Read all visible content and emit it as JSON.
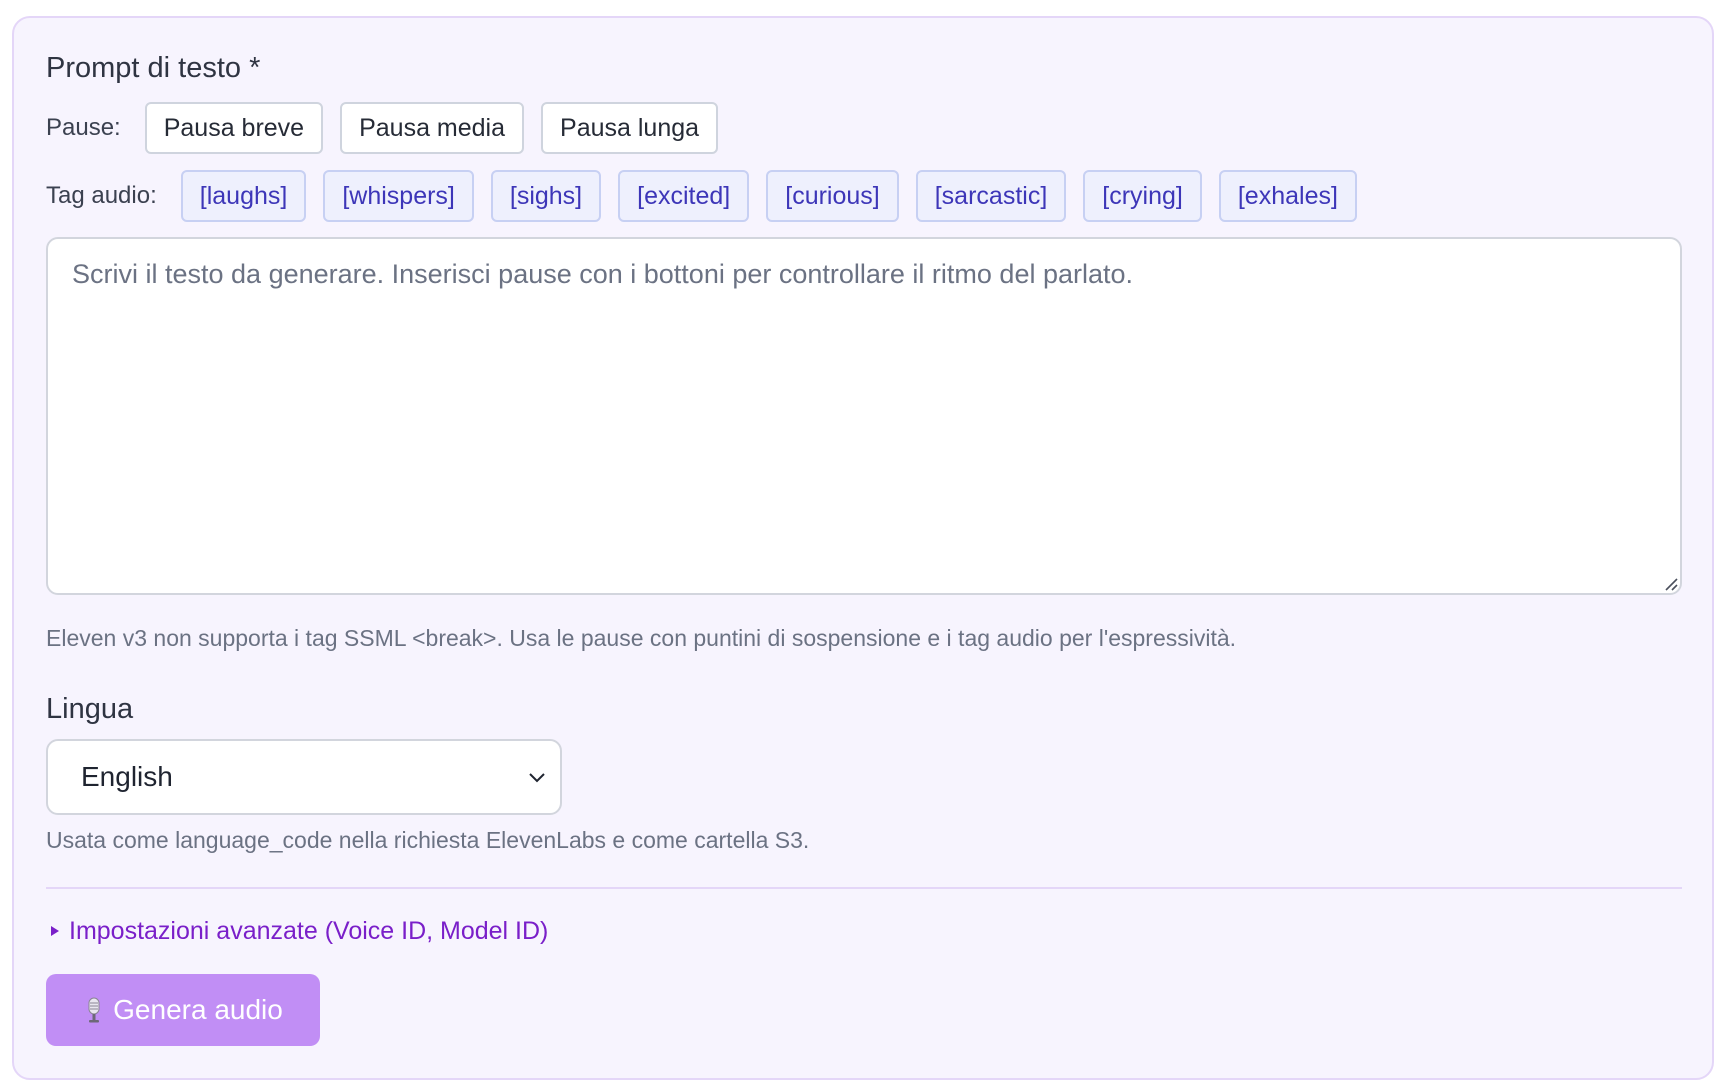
{
  "prompt": {
    "title": "Prompt di testo *",
    "pause_label": "Pause:",
    "pause_buttons": [
      "Pausa breve",
      "Pausa media",
      "Pausa lunga"
    ],
    "tag_label": "Tag audio:",
    "tag_buttons": [
      "[laughs]",
      "[whispers]",
      "[sighs]",
      "[excited]",
      "[curious]",
      "[sarcastic]",
      "[crying]",
      "[exhales]"
    ],
    "textarea_value": "",
    "textarea_placeholder": "Scrivi il testo da generare. Inserisci pause con i bottoni per controllare il ritmo del parlato.",
    "help": "Eleven v3 non supporta i tag SSML <break>. Usa le pause con puntini di sospensione e i tag audio per l'espressività."
  },
  "language": {
    "title": "Lingua",
    "selected": "English",
    "help": "Usata come language_code nella richiesta ElevenLabs e come cartella S3."
  },
  "advanced": {
    "label": "Impostazioni avanzate (Voice ID, Model ID)",
    "expanded": false
  },
  "generate": {
    "icon": "microphone-icon",
    "label": "Genera audio"
  },
  "colors": {
    "card_bg": "#f7f4fe",
    "card_border": "#e4d6f8",
    "tag_text": "#3d36b8",
    "tag_bg": "#eef0fd",
    "advanced_link": "#7a1fc9",
    "generate_bg": "#c18ef5"
  }
}
